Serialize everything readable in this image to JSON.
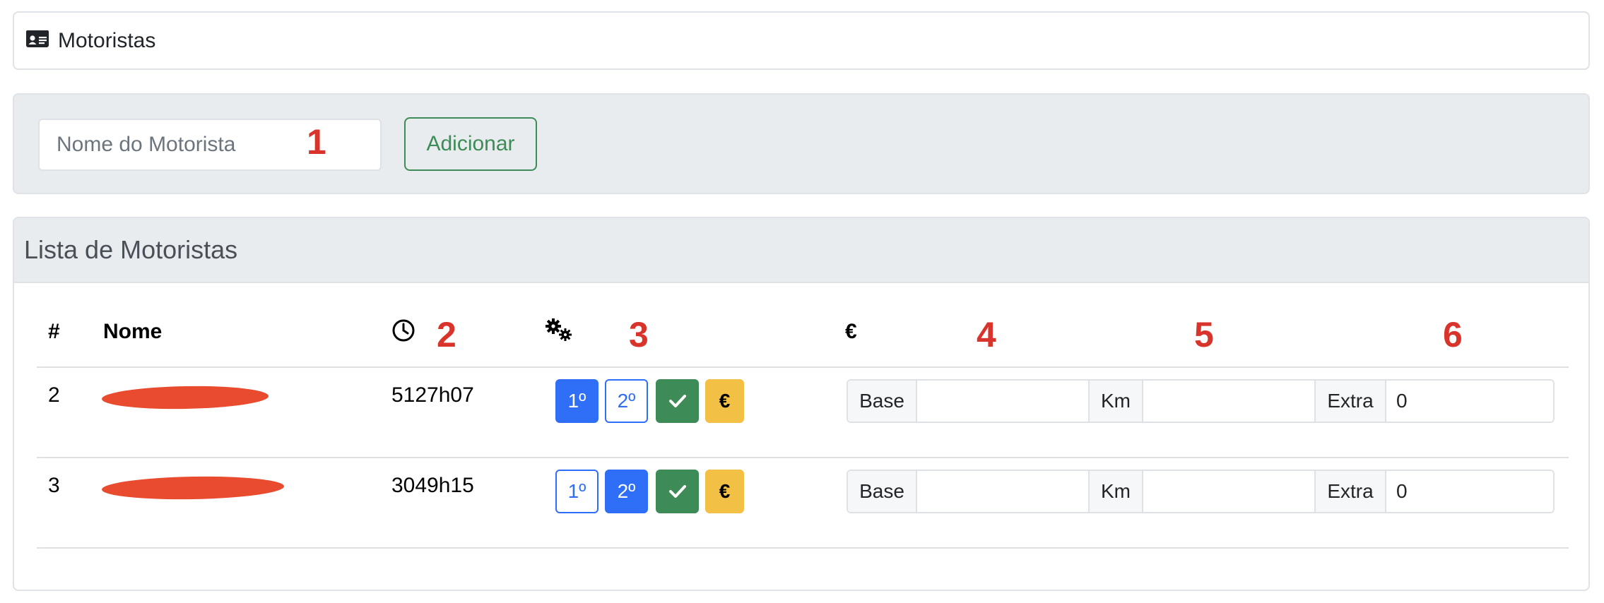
{
  "header": {
    "title": "Motoristas",
    "icon": "id-card-icon"
  },
  "form": {
    "name_placeholder": "Nome do Motorista",
    "add_label": "Adicionar",
    "annotation": "1"
  },
  "list": {
    "title": "Lista de Motoristas",
    "columns": {
      "index": "#",
      "name": "Nome",
      "time_icon": "clock-icon",
      "actions_icon": "cogs-icon",
      "pay_icon": "euro-icon"
    },
    "annotations": {
      "time": "2",
      "actions": "3",
      "base": "4",
      "km": "5",
      "extra": "6"
    },
    "rows": [
      {
        "index": "2",
        "name": "[redacted]",
        "time": "5127h07",
        "first_label": "1º",
        "second_label": "2º",
        "first_active": true,
        "second_active": false,
        "confirm_icon": "check-icon",
        "pay_label": "€",
        "base_label": "Base",
        "base_value": "",
        "km_label": "Km",
        "km_value": "",
        "extra_label": "Extra",
        "extra_value": "0"
      },
      {
        "index": "3",
        "name": "[redacted]",
        "time": "3049h15",
        "first_label": "1º",
        "second_label": "2º",
        "first_active": false,
        "second_active": true,
        "confirm_icon": "check-icon",
        "pay_label": "€",
        "base_label": "Base",
        "base_value": "",
        "km_label": "Km",
        "km_value": "",
        "extra_label": "Extra",
        "extra_value": "0"
      }
    ]
  },
  "colors": {
    "primary": "#2f6ef6",
    "success": "#3d8c57",
    "warning": "#f2c044",
    "annotation": "#d9342b",
    "panel": "#e9ecef"
  }
}
